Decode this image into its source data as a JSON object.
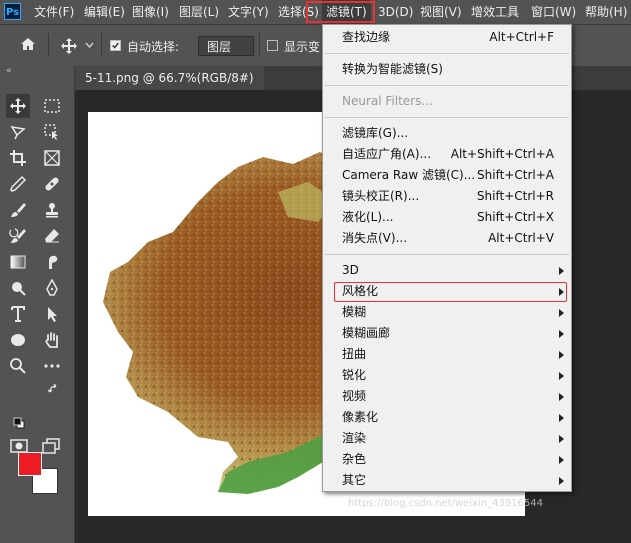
{
  "menubar": {
    "logo": "Ps",
    "items": [
      {
        "label": "文件(F)"
      },
      {
        "label": "编辑(E)"
      },
      {
        "label": "图像(I)"
      },
      {
        "label": "图层(L)"
      },
      {
        "label": "文字(Y)"
      },
      {
        "label": "选择(S)"
      },
      {
        "label": "滤镜(T)"
      },
      {
        "label": "3D(D)"
      },
      {
        "label": "视图(V)"
      },
      {
        "label": "增效工具"
      },
      {
        "label": "窗口(W)"
      },
      {
        "label": "帮助(H)"
      }
    ]
  },
  "options": {
    "auto_select_label": "自动选择:",
    "auto_select_value": "图层",
    "show_transform_label": "显示变"
  },
  "document": {
    "tab_title": "5-11.png @ 66.7%(RGB/8#)"
  },
  "colors": {
    "foreground": "#ed1c24",
    "background": "#ffffff",
    "highlight": "#e53333"
  },
  "filter_menu": {
    "items": [
      {
        "label": "查找边缘",
        "shortcut": "Alt+Ctrl+F"
      },
      {
        "label": "转换为智能滤镜(S)",
        "shortcut": ""
      },
      {
        "label": "Neural Filters...",
        "shortcut": ""
      },
      {
        "label": "滤镜库(G)...",
        "shortcut": ""
      },
      {
        "label": "自适应广角(A)...",
        "shortcut": "Alt+Shift+Ctrl+A"
      },
      {
        "label": "Camera Raw 滤镜(C)...",
        "shortcut": "Shift+Ctrl+A"
      },
      {
        "label": "镜头校正(R)...",
        "shortcut": "Shift+Ctrl+R"
      },
      {
        "label": "液化(L)...",
        "shortcut": "Shift+Ctrl+X"
      },
      {
        "label": "消失点(V)...",
        "shortcut": "Alt+Ctrl+V"
      },
      {
        "label": "3D",
        "shortcut": ""
      },
      {
        "label": "风格化",
        "shortcut": ""
      },
      {
        "label": "模糊",
        "shortcut": ""
      },
      {
        "label": "模糊画廊",
        "shortcut": ""
      },
      {
        "label": "扭曲",
        "shortcut": ""
      },
      {
        "label": "锐化",
        "shortcut": ""
      },
      {
        "label": "视频",
        "shortcut": ""
      },
      {
        "label": "像素化",
        "shortcut": ""
      },
      {
        "label": "渲染",
        "shortcut": ""
      },
      {
        "label": "杂色",
        "shortcut": ""
      },
      {
        "label": "其它",
        "shortcut": ""
      }
    ]
  },
  "toolbar": {
    "tools": [
      "move-icon",
      "marquee-icon",
      "lasso-icon",
      "object-select-icon",
      "crop-icon",
      "frame-icon",
      "eyedropper-icon",
      "healing-icon",
      "brush-icon",
      "stamp-icon",
      "history-brush-icon",
      "eraser-icon",
      "gradient-icon",
      "smudge-icon",
      "dodge-icon",
      "pen-icon",
      "type-icon",
      "path-select-icon",
      "ellipse-icon",
      "hand-icon",
      "zoom-icon",
      "more-icon"
    ]
  },
  "watermark": "https://blog.csdn.net/weixin_43916544"
}
